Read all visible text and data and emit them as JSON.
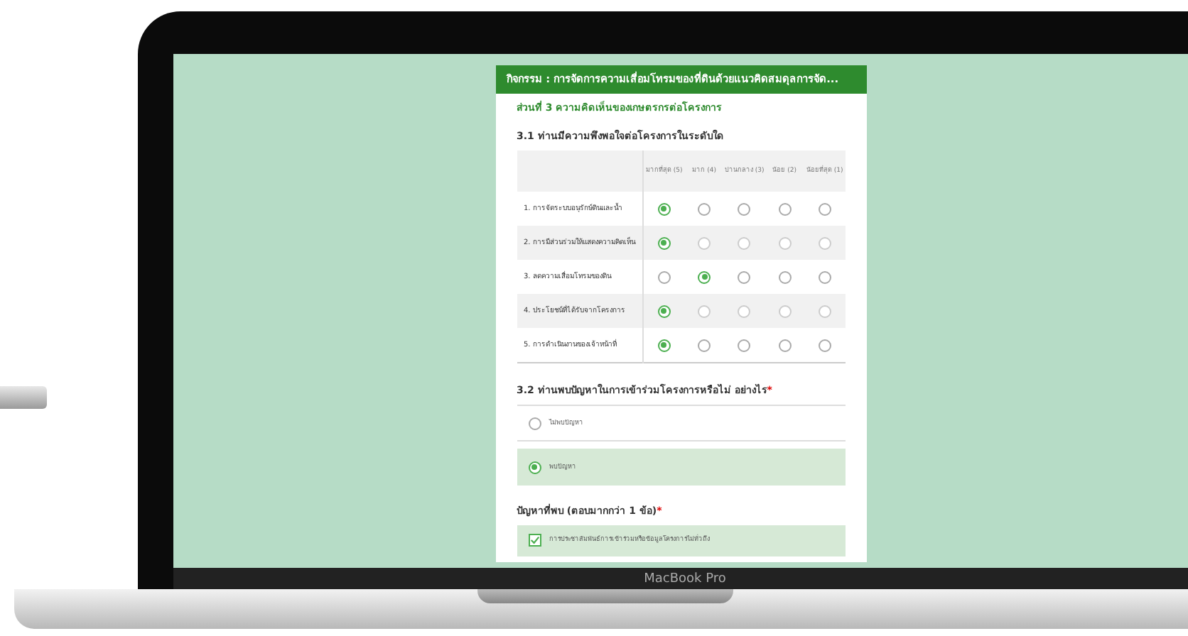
{
  "form": {
    "title": "กิจกรรม : การจัดการความเสื่อมโทรมของที่ดินด้วยแนวคิดสมดุลการจัด...",
    "section": "ส่วนที่ 3 ความคิดเห็นของเกษตรกรต่อโครงการ",
    "q1": {
      "question": "3.1 ท่านมีความพึงพอใจต่อโครงการในระดับใด",
      "columns": [
        "มากที่สุด (5)",
        "มาก (4)",
        "ปานกลาง (3)",
        "น้อย (2)",
        "น้อยที่สุด (1)"
      ],
      "rows": [
        {
          "label": "1. การจัดระบบอนุรักษ์ดินและน้ำ",
          "choices": [
            {
              "selected": true
            },
            {
              "selected": false
            },
            {
              "selected": false
            },
            {
              "selected": false
            },
            {
              "selected": false
            }
          ]
        },
        {
          "label": "2. การมีส่วนร่วมให้แสดงความคิดเห็น",
          "choices": [
            {
              "selected": true
            },
            {
              "selected": false
            },
            {
              "selected": false
            },
            {
              "selected": false
            },
            {
              "selected": false
            }
          ]
        },
        {
          "label": "3. ลดความเสื่อมโทรมของดิน",
          "choices": [
            {
              "selected": false
            },
            {
              "selected": true
            },
            {
              "selected": false
            },
            {
              "selected": false
            },
            {
              "selected": false
            }
          ]
        },
        {
          "label": "4. ประโยชน์ที่ได้รับจากโครงการ",
          "choices": [
            {
              "selected": true
            },
            {
              "selected": false
            },
            {
              "selected": false
            },
            {
              "selected": false
            },
            {
              "selected": false
            }
          ]
        },
        {
          "label": "5. การดำเนินงานของเจ้าหน้าที่",
          "choices": [
            {
              "selected": true
            },
            {
              "selected": false
            },
            {
              "selected": false
            },
            {
              "selected": false
            },
            {
              "selected": false
            }
          ]
        }
      ]
    },
    "q2": {
      "question": "3.2 ท่านพบปัญหาในการเข้าร่วมโครงการหรือไม่ อย่างไร",
      "required_mark": "*",
      "options": [
        {
          "label": "ไม่พบปัญหา",
          "selected": false
        },
        {
          "label": "พบปัญหา",
          "selected": true
        }
      ]
    },
    "q3": {
      "question": "ปัญหาที่พบ (ตอบมากกว่า 1 ข้อ)",
      "required_mark": "*",
      "options": [
        {
          "label": "การประชาสัมพันธ์การเข้าร่วมหรือข้อมูลโครงการไม่ทั่วถึง",
          "checked": true
        }
      ]
    }
  },
  "device": {
    "label": "MacBook Pro"
  }
}
